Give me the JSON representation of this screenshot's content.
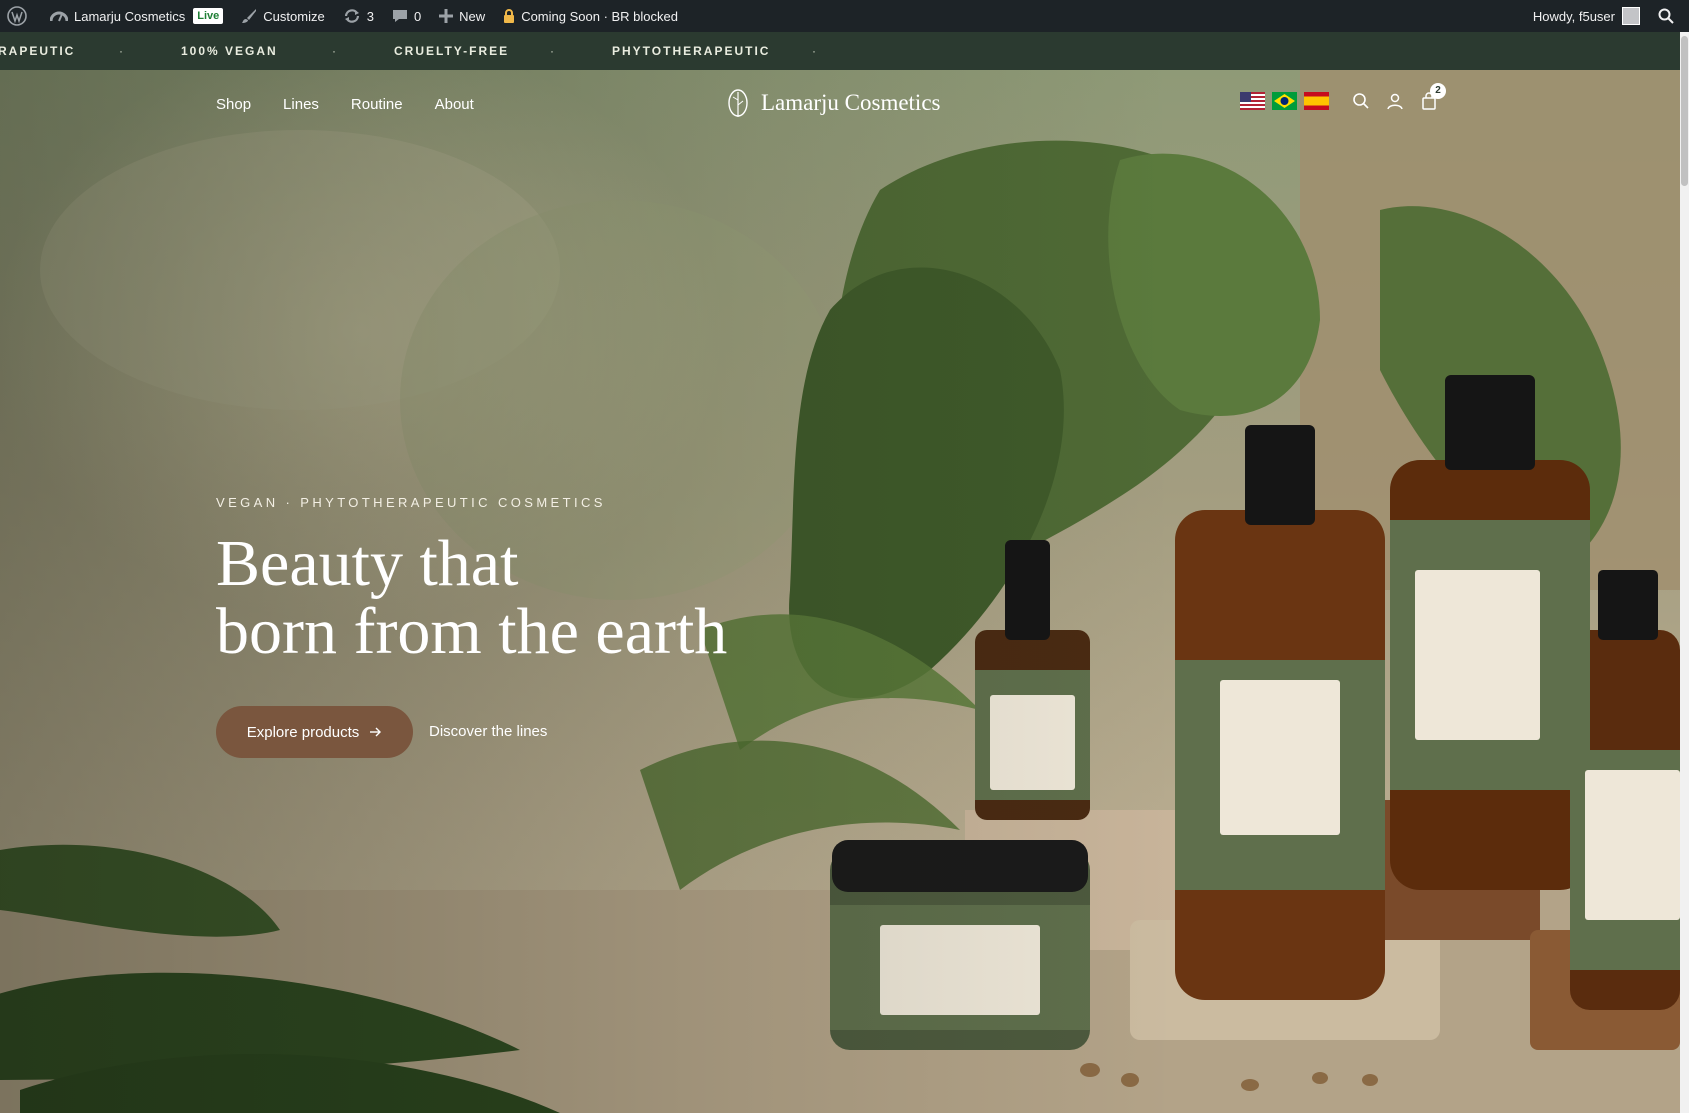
{
  "adminbar": {
    "site_name": "Lamarju Cosmetics",
    "live_badge": "Live",
    "customize": "Customize",
    "updates_count": "3",
    "comments_count": "0",
    "new_label": "New",
    "coming_soon": "Coming Soon · BR blocked",
    "howdy": "Howdy, f5user",
    "icons": [
      "wordpress-icon",
      "dashboard-icon",
      "brush-icon",
      "updates-icon",
      "comment-icon",
      "plus-icon",
      "lock-icon",
      "search-icon"
    ]
  },
  "strip": {
    "items": [
      "RAPEUTIC",
      "100% VEGAN",
      "CRUELTY-FREE",
      "PHYTOTHERAPEUTIC"
    ],
    "separator": "·"
  },
  "nav": {
    "items": [
      "Shop",
      "Lines",
      "Routine",
      "About"
    ],
    "brand": "Lamarju Cosmetics",
    "cart_count": "2",
    "flags": [
      "us-flag",
      "br-flag",
      "es-flag"
    ]
  },
  "hero": {
    "eyebrow": "VEGAN · PHYTOTHERAPEUTIC COSMETICS",
    "headline_line1": "Beauty that",
    "headline_line2": "born from the earth",
    "cta_primary": "Explore products",
    "cta_secondary": "Discover the lines"
  },
  "colors": {
    "admin_bg": "#1d2327",
    "strip_bg": "#2b3a30",
    "cta_bg": "#7a563e"
  }
}
